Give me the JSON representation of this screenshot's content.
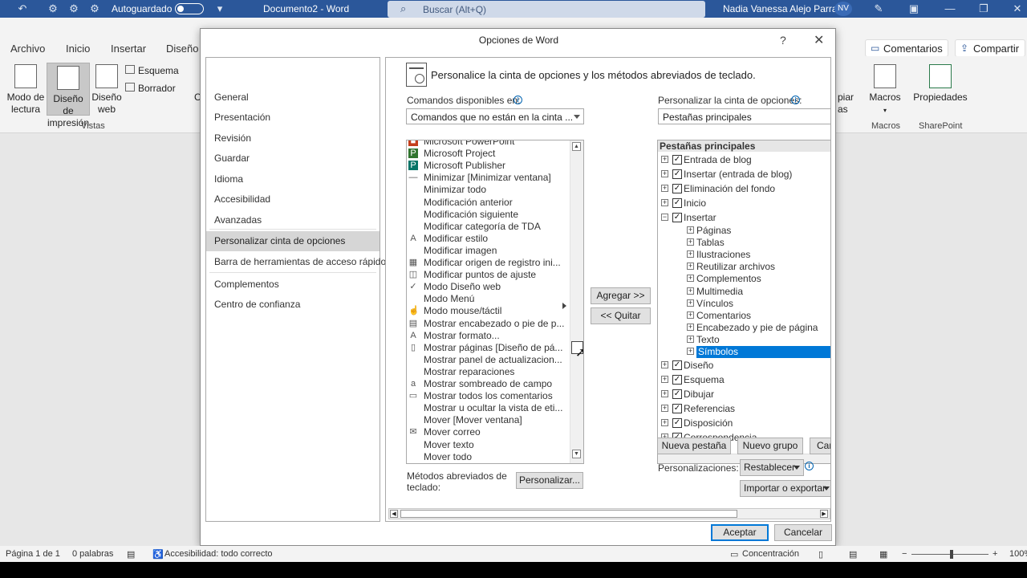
{
  "word": {
    "titlebar": {
      "autosave_label": "Autoguardado",
      "doc_title": "Documento2 - Word",
      "search_placeholder": "Buscar (Alt+Q)",
      "user_name": "Nadia Vanessa Alejo Parra",
      "user_initials": "NV"
    },
    "tabs": [
      "Archivo",
      "Inicio",
      "Insertar",
      "Diseño"
    ],
    "right_tabs": {
      "comments": "Comentarios",
      "share": "Compartir"
    },
    "ribbon": {
      "views": {
        "read_mode": "Modo de lectura",
        "print_layout": "Diseño de impresión",
        "web_layout": "Diseño web",
        "outline": "Esquema",
        "draft": "Borrador",
        "group": "Vistas"
      },
      "macros": {
        "label": "Macros",
        "group": "Macros"
      },
      "sharepoint": {
        "label": "Propiedades",
        "group": "SharePoint"
      },
      "partial_left": "C",
      "partial_right": [
        "piar",
        "as"
      ]
    },
    "status": {
      "page": "Página 1 de 1",
      "words": "0 palabras",
      "accessibility": "Accesibilidad: todo correcto",
      "focus": "Concentración",
      "zoom": "100%"
    }
  },
  "dialog": {
    "title": "Opciones de Word",
    "help": "?",
    "close": "✕",
    "nav_items": [
      "General",
      "Presentación",
      "Revisión",
      "Guardar",
      "Idioma",
      "Accesibilidad",
      "Avanzadas",
      "Personalizar cinta de opciones",
      "Barra de herramientas de acceso rápido",
      "Complementos",
      "Centro de confianza"
    ],
    "selected_nav": "Personalizar cinta de opciones",
    "heading": "Personalice la cinta de opciones y los métodos abreviados de teclado.",
    "commands_label": "Comandos disponibles en:",
    "commands_source": "Comandos que no están en la cinta ...",
    "customize_label": "Personalizar la cinta de opciones:",
    "customize_value": "Pestañas principales",
    "commands": [
      {
        "label": "Microsoft PowerPoint",
        "icon": "powerpoint-icon"
      },
      {
        "label": "Microsoft Project",
        "icon": "project-icon"
      },
      {
        "label": "Microsoft Publisher",
        "icon": "publisher-icon"
      },
      {
        "label": "Minimizar [Minimizar ventana]",
        "icon": "minimize-icon"
      },
      {
        "label": "Minimizar todo",
        "icon": ""
      },
      {
        "label": "Modificación anterior",
        "icon": ""
      },
      {
        "label": "Modificación siguiente",
        "icon": ""
      },
      {
        "label": "Modificar categoría de TDA",
        "icon": ""
      },
      {
        "label": "Modificar estilo",
        "icon": "style-icon"
      },
      {
        "label": "Modificar imagen",
        "icon": ""
      },
      {
        "label": "Modificar origen de registro ini...",
        "icon": "table-icon"
      },
      {
        "label": "Modificar puntos de ajuste",
        "icon": "points-icon"
      },
      {
        "label": "Modo Diseño web",
        "icon": "check-icon"
      },
      {
        "label": "Modo Menú",
        "icon": ""
      },
      {
        "label": "Modo mouse/táctil",
        "icon": "touch-icon"
      },
      {
        "label": "Mostrar encabezado o pie de p...",
        "icon": "header-icon"
      },
      {
        "label": "Mostrar formato...",
        "icon": "format-icon"
      },
      {
        "label": "Mostrar páginas [Diseño de pá...",
        "icon": "pages-icon"
      },
      {
        "label": "Mostrar panel de actualizacion...",
        "icon": ""
      },
      {
        "label": "Mostrar reparaciones",
        "icon": ""
      },
      {
        "label": "Mostrar sombreado de campo",
        "icon": "shading-icon"
      },
      {
        "label": "Mostrar todos los comentarios",
        "icon": "comment-icon"
      },
      {
        "label": "Mostrar u ocultar la vista de eti...",
        "icon": ""
      },
      {
        "label": "Mover [Mover ventana]",
        "icon": ""
      },
      {
        "label": "Mover correo",
        "icon": "mail-icon"
      },
      {
        "label": "Mover texto",
        "icon": ""
      },
      {
        "label": "Mover todo",
        "icon": ""
      }
    ],
    "add_button": "Agregar >>",
    "remove_button": "<< Quitar",
    "tree_header": "Pestañas principales",
    "tree": [
      {
        "label": "Entrada de blog",
        "level": 0,
        "expanded": false,
        "checked": true
      },
      {
        "label": "Insertar (entrada de blog)",
        "level": 0,
        "expanded": false,
        "checked": true
      },
      {
        "label": "Eliminación del fondo",
        "level": 0,
        "expanded": false,
        "checked": true
      },
      {
        "label": "Inicio",
        "level": 0,
        "expanded": false,
        "checked": true
      },
      {
        "label": "Insertar",
        "level": 0,
        "expanded": true,
        "checked": true
      },
      {
        "label": "Páginas",
        "level": 1
      },
      {
        "label": "Tablas",
        "level": 1
      },
      {
        "label": "Ilustraciones",
        "level": 1
      },
      {
        "label": "Reutilizar archivos",
        "level": 1
      },
      {
        "label": "Complementos",
        "level": 1
      },
      {
        "label": "Multimedia",
        "level": 1
      },
      {
        "label": "Vínculos",
        "level": 1
      },
      {
        "label": "Comentarios",
        "level": 1
      },
      {
        "label": "Encabezado y pie de página",
        "level": 1
      },
      {
        "label": "Texto",
        "level": 1
      },
      {
        "label": "Símbolos",
        "level": 1,
        "selected": true
      },
      {
        "label": "Diseño",
        "level": 0,
        "expanded": false,
        "checked": true
      },
      {
        "label": "Esquema",
        "level": 0,
        "expanded": false,
        "checked": true
      },
      {
        "label": "Dibujar",
        "level": 0,
        "expanded": false,
        "checked": true
      },
      {
        "label": "Referencias",
        "level": 0,
        "expanded": false,
        "checked": true
      },
      {
        "label": "Disposición",
        "level": 0,
        "expanded": false,
        "checked": true
      },
      {
        "label": "Correspondencia",
        "level": 0,
        "expanded": false,
        "checked": true
      }
    ],
    "new_tab_button": "Nueva pestaña",
    "new_group_button": "Nuevo grupo",
    "rename_button": "Cambiar nombre...",
    "customizations_label": "Personalizaciones:",
    "reset_button": "Restablecer",
    "import_export_button": "Importar o exportar",
    "shortcuts_label": "Métodos abreviados de teclado:",
    "customize_button": "Personalizar...",
    "ok_button": "Aceptar",
    "cancel_button": "Cancelar"
  }
}
